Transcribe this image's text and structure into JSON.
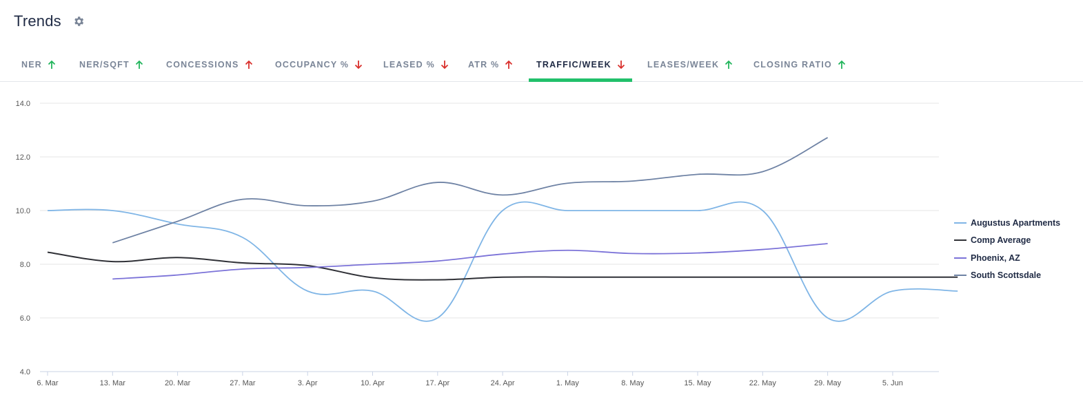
{
  "header": {
    "title": "Trends",
    "settings_icon": "gear-icon"
  },
  "tabs": [
    {
      "label": "NER",
      "trend": "up"
    },
    {
      "label": "NER/SQFT",
      "trend": "up"
    },
    {
      "label": "CONCESSIONS",
      "trend": "up"
    },
    {
      "label": "OCCUPANCY %",
      "trend": "down"
    },
    {
      "label": "LEASED %",
      "trend": "down"
    },
    {
      "label": "ATR %",
      "trend": "up"
    },
    {
      "label": "TRAFFIC/WEEK",
      "trend": "down",
      "active": true
    },
    {
      "label": "LEASES/WEEK",
      "trend": "up"
    },
    {
      "label": "CLOSING RATIO",
      "trend": "up"
    }
  ],
  "colors": {
    "trend_up": "#22b55c",
    "trend_down": "#d9302c",
    "active_underline": "#22c06b"
  },
  "chart_data": {
    "type": "line",
    "x": [
      "6. Mar",
      "13. Mar",
      "20. Mar",
      "27. Mar",
      "3. Apr",
      "10. Apr",
      "17. Apr",
      "24. Apr",
      "1. May",
      "8. May",
      "15. May",
      "22. May",
      "29. May",
      "5. Jun"
    ],
    "yticks": [
      "4.0",
      "6.0",
      "8.0",
      "10.0",
      "12.0",
      "14.0"
    ],
    "ylim": [
      4,
      14
    ],
    "grid": true,
    "legend_position": "right",
    "series": [
      {
        "name": "Augustus Apartments",
        "color": "#7fb5e6",
        "values": [
          10,
          10,
          9.5,
          9,
          7,
          7,
          6,
          10,
          10,
          10,
          10,
          10,
          6,
          7,
          7
        ]
      },
      {
        "name": "Comp Average",
        "color": "#2f3036",
        "values": [
          8.45,
          8.1,
          8.25,
          8.05,
          7.95,
          7.5,
          7.42,
          7.52,
          7.52,
          7.52,
          7.52,
          7.52,
          7.52,
          7.52,
          7.52
        ]
      },
      {
        "name": "Phoenix, AZ",
        "color": "#7b72d8",
        "values": [
          null,
          7.45,
          7.6,
          7.82,
          7.88,
          8.0,
          8.12,
          8.38,
          8.52,
          8.4,
          8.42,
          8.55,
          8.77,
          null,
          null
        ]
      },
      {
        "name": "South Scottsdale",
        "color": "#6e82a4",
        "values": [
          null,
          8.8,
          9.6,
          10.42,
          10.18,
          10.35,
          11.05,
          10.58,
          11.02,
          11.1,
          11.35,
          11.45,
          12.72,
          null,
          null
        ]
      }
    ]
  }
}
